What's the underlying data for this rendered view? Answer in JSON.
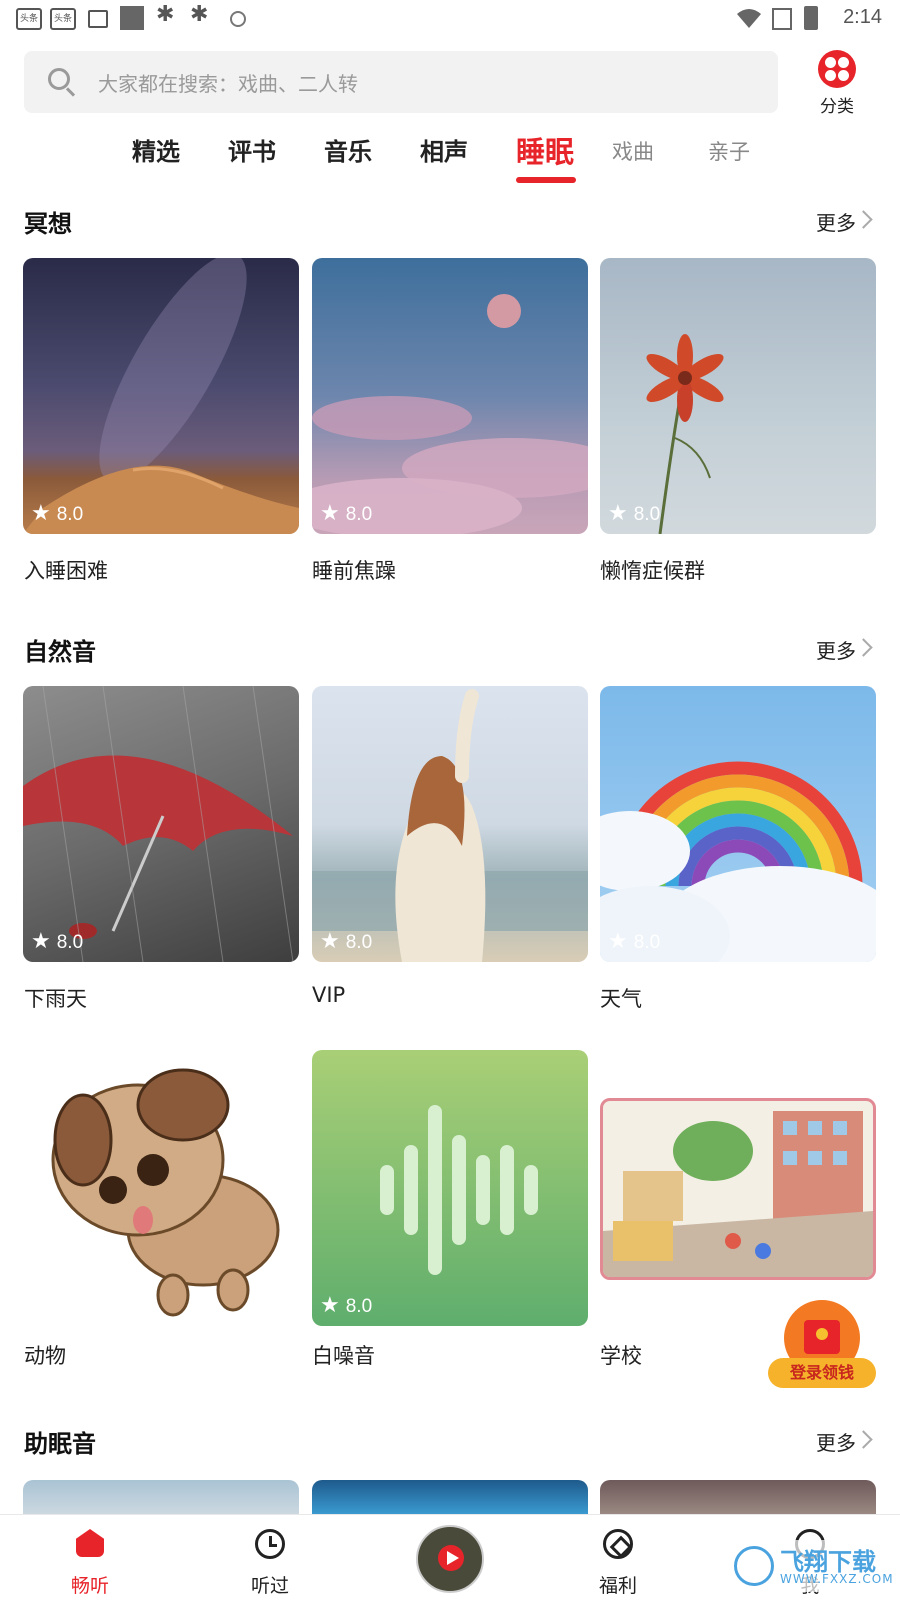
{
  "status_bar": {
    "time": "2:14",
    "notification_icons": [
      "头条",
      "头条"
    ]
  },
  "search": {
    "placeholder": "大家都在搜索：戏曲、二人转"
  },
  "category_button": {
    "label": "分类"
  },
  "tabs": [
    {
      "label": "精选"
    },
    {
      "label": "评书"
    },
    {
      "label": "音乐"
    },
    {
      "label": "相声"
    },
    {
      "label": "睡眠"
    },
    {
      "label": "戏曲"
    },
    {
      "label": "亲子"
    }
  ],
  "active_tab": "睡眠",
  "sections": [
    {
      "title": "冥想",
      "more": "更多",
      "items": [
        {
          "label": "入睡困难",
          "rating": "8.0"
        },
        {
          "label": "睡前焦躁",
          "rating": "8.0"
        },
        {
          "label": "懒惰症候群",
          "rating": "8.0"
        }
      ]
    },
    {
      "title": "自然音",
      "more": "更多",
      "items": [
        {
          "label": "下雨天",
          "rating": "8.0"
        },
        {
          "label": "VIP",
          "rating": "8.0"
        },
        {
          "label": "天气",
          "rating": "8.0"
        },
        {
          "label": "动物"
        },
        {
          "label": "白噪音",
          "rating": "8.0"
        },
        {
          "label": "学校"
        }
      ]
    },
    {
      "title": "助眠音",
      "more": "更多"
    }
  ],
  "promo": {
    "label": "登录领钱"
  },
  "bottom_nav": [
    {
      "label": "畅听",
      "icon": "home-icon",
      "active": true
    },
    {
      "label": "听过",
      "icon": "clock-icon"
    },
    {
      "label": "",
      "icon": "player-icon"
    },
    {
      "label": "福利",
      "icon": "gift-icon"
    },
    {
      "label": "我",
      "icon": "profile-icon"
    }
  ],
  "watermark": {
    "text": "飞翔下载",
    "url": "WWW.FXXZ.COM"
  },
  "colors": {
    "accent": "#e8242b"
  }
}
